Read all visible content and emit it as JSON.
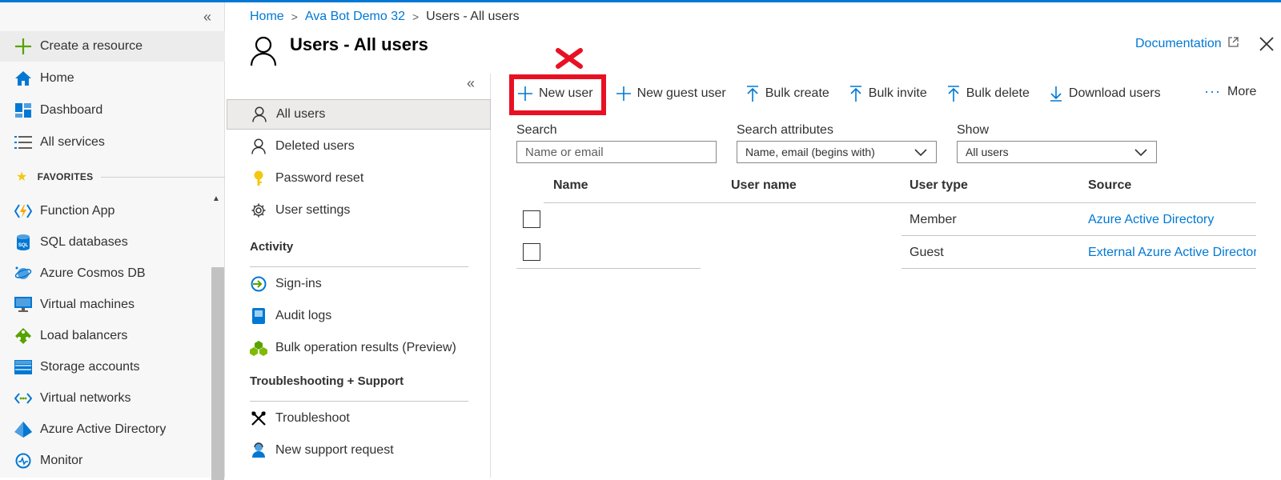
{
  "breadcrumb": {
    "home": "Home",
    "tenant": "Ava Bot Demo 32",
    "current": "Users - All users"
  },
  "leftnav": {
    "collapse": "«",
    "items": [
      {
        "label": "Create a resource",
        "icon": "plus-icon"
      },
      {
        "label": "Home",
        "icon": "home-icon"
      },
      {
        "label": "Dashboard",
        "icon": "dashboard-icon"
      },
      {
        "label": "All services",
        "icon": "list-icon"
      }
    ],
    "favorites_header": "FAVORITES",
    "favorites": [
      {
        "label": "Function App",
        "icon": "function-app-icon"
      },
      {
        "label": "SQL databases",
        "icon": "sql-icon"
      },
      {
        "label": "Azure Cosmos DB",
        "icon": "cosmos-icon"
      },
      {
        "label": "Virtual machines",
        "icon": "vm-icon"
      },
      {
        "label": "Load balancers",
        "icon": "load-balancer-icon"
      },
      {
        "label": "Storage accounts",
        "icon": "storage-icon"
      },
      {
        "label": "Virtual networks",
        "icon": "vnet-icon"
      },
      {
        "label": "Azure Active Directory",
        "icon": "aad-icon"
      },
      {
        "label": "Monitor",
        "icon": "monitor-icon"
      }
    ],
    "sql_badge": "SQL"
  },
  "blade": {
    "title": "Users - All users",
    "documentation": "Documentation"
  },
  "menu": {
    "collapse": "«",
    "items": [
      {
        "label": "All users",
        "icon": "user-icon"
      },
      {
        "label": "Deleted users",
        "icon": "user-icon"
      },
      {
        "label": "Password reset",
        "icon": "key-icon"
      },
      {
        "label": "User settings",
        "icon": "gear-icon"
      }
    ],
    "activity_header": "Activity",
    "activity": [
      {
        "label": "Sign-ins",
        "icon": "sign-in-icon"
      },
      {
        "label": "Audit logs",
        "icon": "audit-log-icon"
      },
      {
        "label": "Bulk operation results (Preview)",
        "icon": "bulk-results-icon"
      }
    ],
    "support_header": "Troubleshooting + Support",
    "support": [
      {
        "label": "Troubleshoot",
        "icon": "wrench-icon"
      },
      {
        "label": "New support request",
        "icon": "support-icon"
      }
    ]
  },
  "toolbar": {
    "new_user": "New user",
    "new_guest_user": "New guest user",
    "bulk_create": "Bulk create",
    "bulk_invite": "Bulk invite",
    "bulk_delete": "Bulk delete",
    "download_users": "Download users",
    "more": "More"
  },
  "filters": {
    "search_label": "Search",
    "search_placeholder": "Name or email",
    "attributes_label": "Search attributes",
    "attributes_value": "Name, email (begins with)",
    "show_label": "Show",
    "show_value": "All users"
  },
  "table": {
    "columns": [
      "Name",
      "User name",
      "User type",
      "Source"
    ],
    "rows": [
      {
        "name": "",
        "user_name": "",
        "user_type": "Member",
        "source": "Azure Active Directory"
      },
      {
        "name": "",
        "user_name": "",
        "user_type": "Guest",
        "source": "External Azure Active Director"
      }
    ]
  },
  "colors": {
    "accent": "#0078d4",
    "highlight": "#e81123"
  }
}
